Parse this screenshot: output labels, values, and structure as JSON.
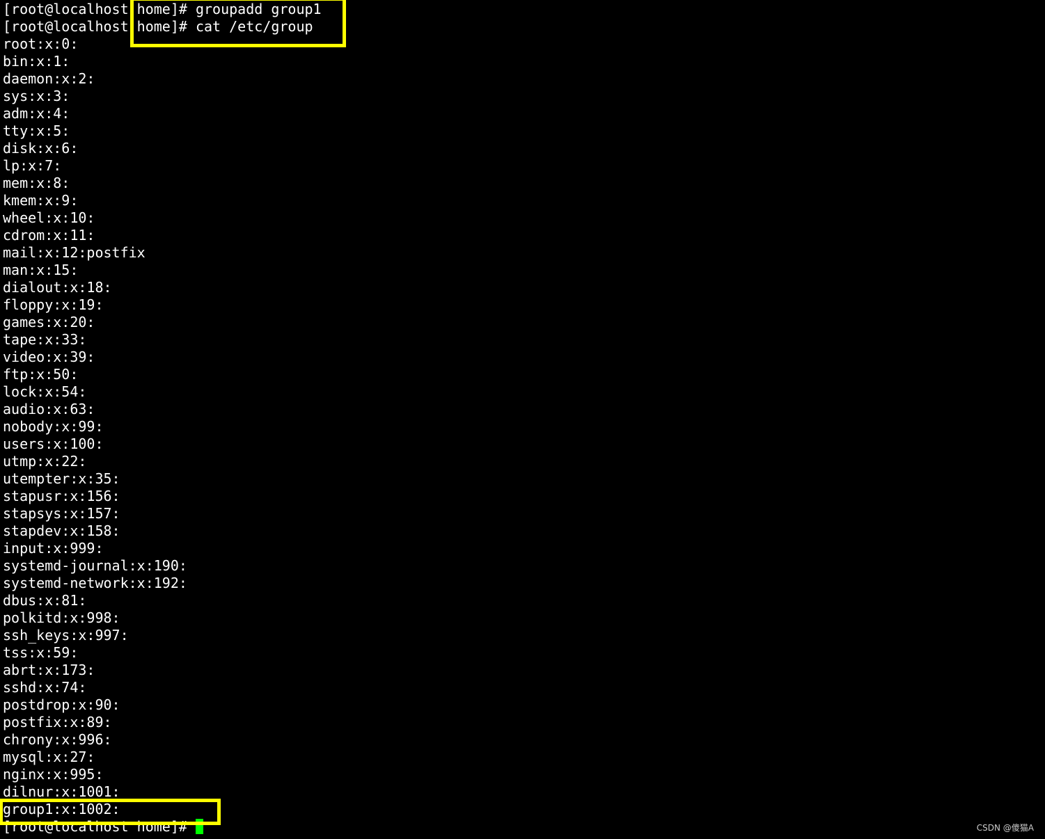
{
  "terminal": {
    "prompt": "[root@localhost home]# ",
    "commands": [
      "groupadd group1",
      "cat /etc/group"
    ],
    "output": [
      "root:x:0:",
      "bin:x:1:",
      "daemon:x:2:",
      "sys:x:3:",
      "adm:x:4:",
      "tty:x:5:",
      "disk:x:6:",
      "lp:x:7:",
      "mem:x:8:",
      "kmem:x:9:",
      "wheel:x:10:",
      "cdrom:x:11:",
      "mail:x:12:postfix",
      "man:x:15:",
      "dialout:x:18:",
      "floppy:x:19:",
      "games:x:20:",
      "tape:x:33:",
      "video:x:39:",
      "ftp:x:50:",
      "lock:x:54:",
      "audio:x:63:",
      "nobody:x:99:",
      "users:x:100:",
      "utmp:x:22:",
      "utempter:x:35:",
      "stapusr:x:156:",
      "stapsys:x:157:",
      "stapdev:x:158:",
      "input:x:999:",
      "systemd-journal:x:190:",
      "systemd-network:x:192:",
      "dbus:x:81:",
      "polkitd:x:998:",
      "ssh_keys:x:997:",
      "tss:x:59:",
      "abrt:x:173:",
      "sshd:x:74:",
      "postdrop:x:90:",
      "postfix:x:89:",
      "chrony:x:996:",
      "mysql:x:27:",
      "nginx:x:995:",
      "dilnur:x:1001:",
      "group1:x:1002:"
    ]
  },
  "watermark": "CSDN @傻猫A",
  "colors": {
    "background": "#000000",
    "text": "#ffffff",
    "cursor": "#00ff00",
    "highlight": "#ffff00"
  }
}
